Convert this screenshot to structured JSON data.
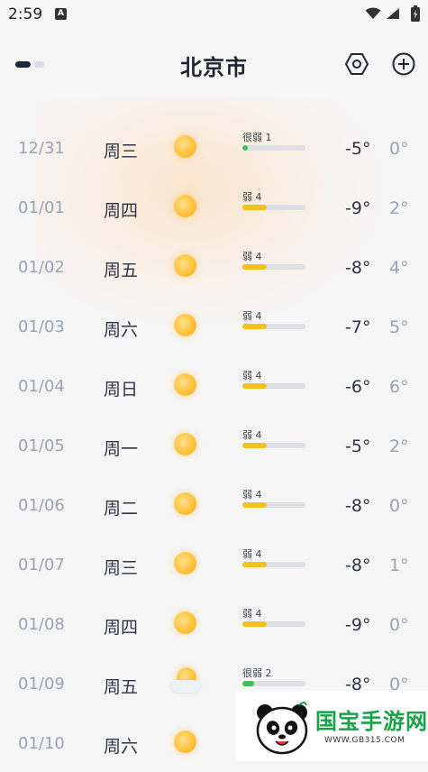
{
  "status_bar": {
    "time": "2:59",
    "notification_letter": "A"
  },
  "header": {
    "city": "北京市"
  },
  "colors": {
    "aqi_good": "#3cc15a",
    "aqi_moderate": "#f2c11c"
  },
  "forecast": [
    {
      "date": "12/31",
      "weekday": "周三",
      "icon": "sun-icon",
      "aqi_label": "很弱 1",
      "aqi_level": 0.08,
      "low": "-5°",
      "high": "0°"
    },
    {
      "date": "01/01",
      "weekday": "周四",
      "icon": "sun-icon",
      "aqi_label": "弱 4",
      "aqi_level": 0.38,
      "low": "-9°",
      "high": "2°"
    },
    {
      "date": "01/02",
      "weekday": "周五",
      "icon": "sun-icon",
      "aqi_label": "弱 4",
      "aqi_level": 0.38,
      "low": "-8°",
      "high": "4°"
    },
    {
      "date": "01/03",
      "weekday": "周六",
      "icon": "sun-icon",
      "aqi_label": "弱 4",
      "aqi_level": 0.38,
      "low": "-7°",
      "high": "5°"
    },
    {
      "date": "01/04",
      "weekday": "周日",
      "icon": "sun-icon",
      "aqi_label": "弱 4",
      "aqi_level": 0.38,
      "low": "-6°",
      "high": "6°"
    },
    {
      "date": "01/05",
      "weekday": "周一",
      "icon": "sun-icon",
      "aqi_label": "弱 4",
      "aqi_level": 0.38,
      "low": "-5°",
      "high": "2°"
    },
    {
      "date": "01/06",
      "weekday": "周二",
      "icon": "sun-icon",
      "aqi_label": "弱 4",
      "aqi_level": 0.38,
      "low": "-8°",
      "high": "0°"
    },
    {
      "date": "01/07",
      "weekday": "周三",
      "icon": "sun-icon",
      "aqi_label": "弱 4",
      "aqi_level": 0.38,
      "low": "-8°",
      "high": "1°"
    },
    {
      "date": "01/08",
      "weekday": "周四",
      "icon": "sun-icon",
      "aqi_label": "弱 4",
      "aqi_level": 0.38,
      "low": "-9°",
      "high": "0°"
    },
    {
      "date": "01/09",
      "weekday": "周五",
      "icon": "partly-cloudy-icon",
      "aqi_label": "很弱 2",
      "aqi_level": 0.18,
      "low": "-8°",
      "high": "0°"
    },
    {
      "date": "01/10",
      "weekday": "周六",
      "icon": "sun-icon",
      "aqi_label": "",
      "aqi_level": 0,
      "low": "",
      "high": ""
    }
  ],
  "watermark": {
    "text": "国宝手游网",
    "url": "WWW.GB315.COM"
  }
}
